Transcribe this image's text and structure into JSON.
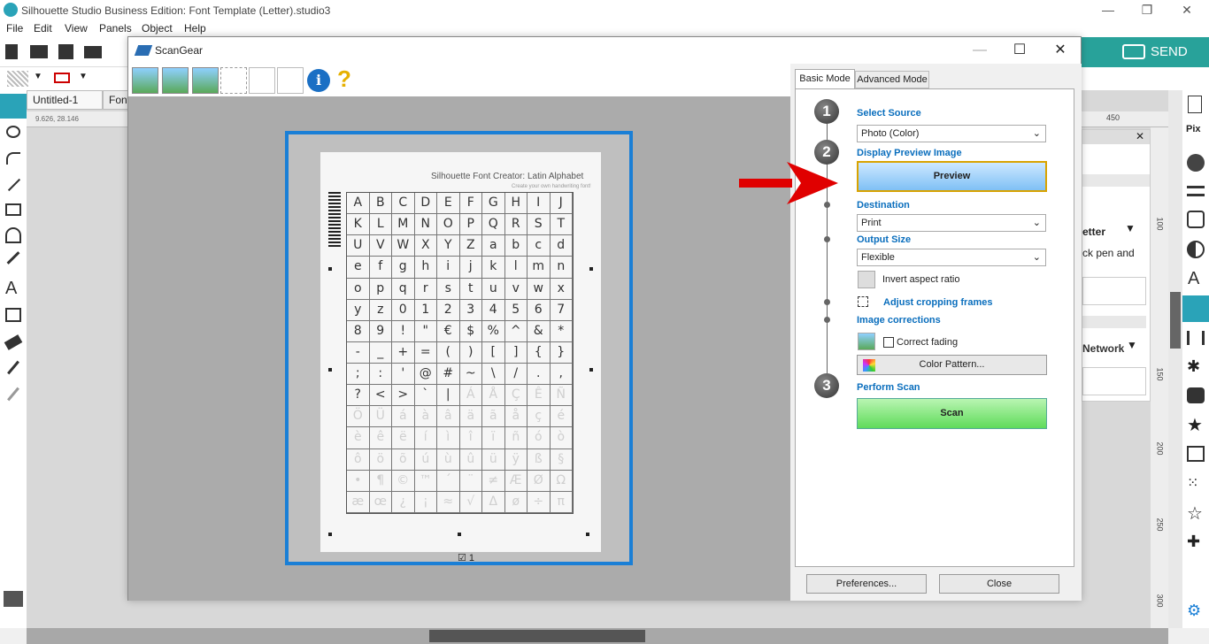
{
  "app": {
    "title": "Silhouette Studio Business Edition: Font Template (Letter).studio3",
    "menu": [
      "File",
      "Edit",
      "View",
      "Panels",
      "Object",
      "Help"
    ],
    "send_label": "SEND",
    "tabs": [
      "Untitled-1",
      "Font"
    ],
    "ruler_readout": "9.626, 28.146",
    "ruler_top_label": "450",
    "ruler_right_labels": [
      "100",
      "150",
      "200",
      "250",
      "300"
    ],
    "bg_panel_texts": [
      "etter",
      "ck pen and",
      "Network"
    ]
  },
  "dialog": {
    "title": "ScanGear",
    "tabs": {
      "basic": "Basic Mode",
      "advanced": "Advanced Mode"
    },
    "steps": {
      "s1": "1",
      "s2": "2",
      "s3": "3",
      "select_source": "Select Source",
      "source_value": "Photo (Color)",
      "display_preview": "Display Preview Image",
      "preview_button": "Preview",
      "destination": "Destination",
      "destination_value": "Print",
      "output_size": "Output Size",
      "output_size_value": "Flexible",
      "invert_aspect": "Invert aspect ratio",
      "adjust_cropping": "Adjust cropping frames",
      "image_corrections": "Image corrections",
      "correct_fading": "Correct fading",
      "color_pattern": "Color Pattern...",
      "perform_scan": "Perform Scan",
      "scan_button": "Scan"
    },
    "footer": {
      "preferences": "Preferences...",
      "close": "Close"
    },
    "preview": {
      "page_title": "Silhouette Font Creator: Latin Alphabet",
      "page_subtitle": "Create your own handwriting font!",
      "page_number": "1",
      "grid_rows": [
        [
          "A",
          "B",
          "C",
          "D",
          "E",
          "F",
          "G",
          "H",
          "I",
          "J"
        ],
        [
          "K",
          "L",
          "M",
          "N",
          "O",
          "P",
          "Q",
          "R",
          "S",
          "T"
        ],
        [
          "U",
          "V",
          "W",
          "X",
          "Y",
          "Z",
          "a",
          "b",
          "c",
          "d"
        ],
        [
          "e",
          "f",
          "g",
          "h",
          "i",
          "j",
          "k",
          "l",
          "m",
          "n"
        ],
        [
          "o",
          "p",
          "q",
          "r",
          "s",
          "t",
          "u",
          "v",
          "w",
          "x"
        ],
        [
          "y",
          "z",
          "0",
          "1",
          "2",
          "3",
          "4",
          "5",
          "6",
          "7"
        ],
        [
          "8",
          "9",
          "!",
          "\"",
          "€",
          "$",
          "%",
          "^",
          "&",
          "*"
        ],
        [
          "-",
          "_",
          "+",
          "=",
          "(",
          ")",
          "[",
          "]",
          "{",
          "}"
        ],
        [
          ";",
          ":",
          "'",
          "@",
          "#",
          "~",
          "\\",
          "/",
          ".",
          ","
        ],
        [
          "?",
          "<",
          ">",
          "`",
          "|",
          "Á",
          "Å",
          "Ç",
          "Ê",
          "Ñ"
        ],
        [
          "Ö",
          "Ü",
          "á",
          "à",
          "â",
          "ä",
          "ã",
          "å",
          "ç",
          "é"
        ],
        [
          "è",
          "ê",
          "ë",
          "í",
          "ì",
          "î",
          "ï",
          "ñ",
          "ó",
          "ò"
        ],
        [
          "ô",
          "ö",
          "õ",
          "ú",
          "ù",
          "û",
          "ü",
          "ÿ",
          "ß",
          "§"
        ],
        [
          "•",
          "¶",
          "©",
          "™",
          "´",
          "¨",
          "≠",
          "Æ",
          "Ø",
          "Ω"
        ],
        [
          "æ",
          "œ",
          "¿",
          "¡",
          "≈",
          "√",
          "Δ",
          "ø",
          "÷",
          "π"
        ]
      ],
      "faint_from_row": 9
    }
  }
}
